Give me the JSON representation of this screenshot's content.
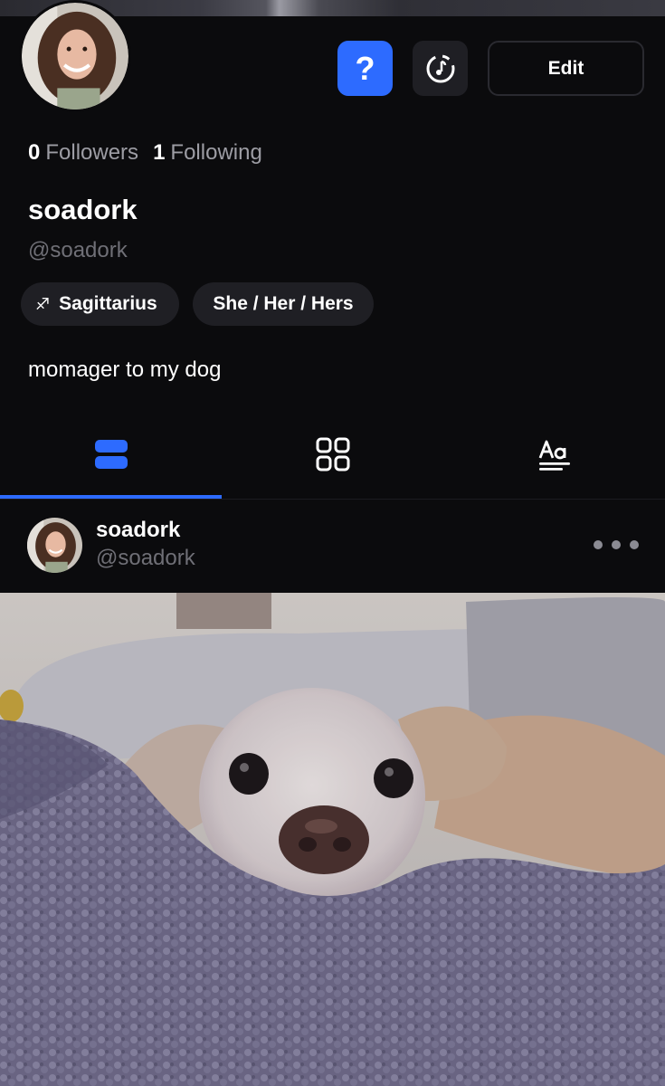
{
  "profile": {
    "followers_count": "0",
    "followers_label": "Followers",
    "following_count": "1",
    "following_label": "Following",
    "display_name": "soadork",
    "handle": "@soadork",
    "zodiac_symbol": "♐",
    "zodiac": "Sagittarius",
    "pronouns": "She / Her / Hers",
    "bio": "momager to my dog"
  },
  "actions": {
    "help_label": "?",
    "edit_label": "Edit"
  },
  "tabs": [
    {
      "icon": "feed-list-icon",
      "active": true
    },
    {
      "icon": "grid-icon",
      "active": false
    },
    {
      "icon": "text-posts-icon",
      "active": false
    }
  ],
  "post": {
    "author_name": "soadork",
    "author_handle": "@soadork"
  },
  "colors": {
    "background": "#0b0b0d",
    "accent": "#2d6bff",
    "chip_bg": "#1f1f24",
    "muted_text": "#6f6f76"
  }
}
